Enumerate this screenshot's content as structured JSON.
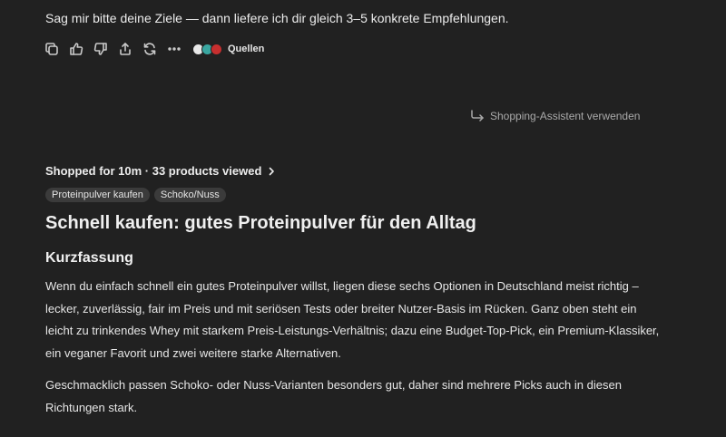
{
  "message": {
    "text": "Sag mir bitte deine Ziele — dann liefere ich dir gleich 3–5 konkrete Empfehlungen."
  },
  "actions": {
    "icons": [
      "copy-icon",
      "thumbs-up-icon",
      "thumbs-down-icon",
      "share-icon",
      "regenerate-icon",
      "more-icon"
    ],
    "sources_label": "Quellen"
  },
  "assistant": {
    "label": "Shopping-Assistent verwenden"
  },
  "shopping": {
    "summary": "Shopped for 10m · 33 products viewed",
    "chips": [
      "Proteinpulver kaufen",
      "Schoko/Nuss"
    ]
  },
  "article": {
    "title": "Schnell kaufen: gutes Proteinpulver für den Alltag",
    "section_title": "Kurzfassung",
    "paragraph1": "Wenn du einfach schnell ein gutes Proteinpulver willst, liegen diese sechs Optionen in Deutschland meist richtig – lecker, zuverlässig, fair im Preis und mit seriösen Tests oder breiter Nutzer-Basis im Rücken. Ganz oben steht ein leicht zu trinkendes Whey mit starkem Preis-Leistungs-Verhältnis; dazu eine Budget-Top-Pick, ein Premium-Klassiker, ein veganer Favorit und zwei weitere starke Alternativen.",
    "paragraph2": "Geschmacklich passen Schoko- oder Nuss-Varianten besonders gut, daher sind mehrere Picks auch in diesen Richtungen stark."
  }
}
